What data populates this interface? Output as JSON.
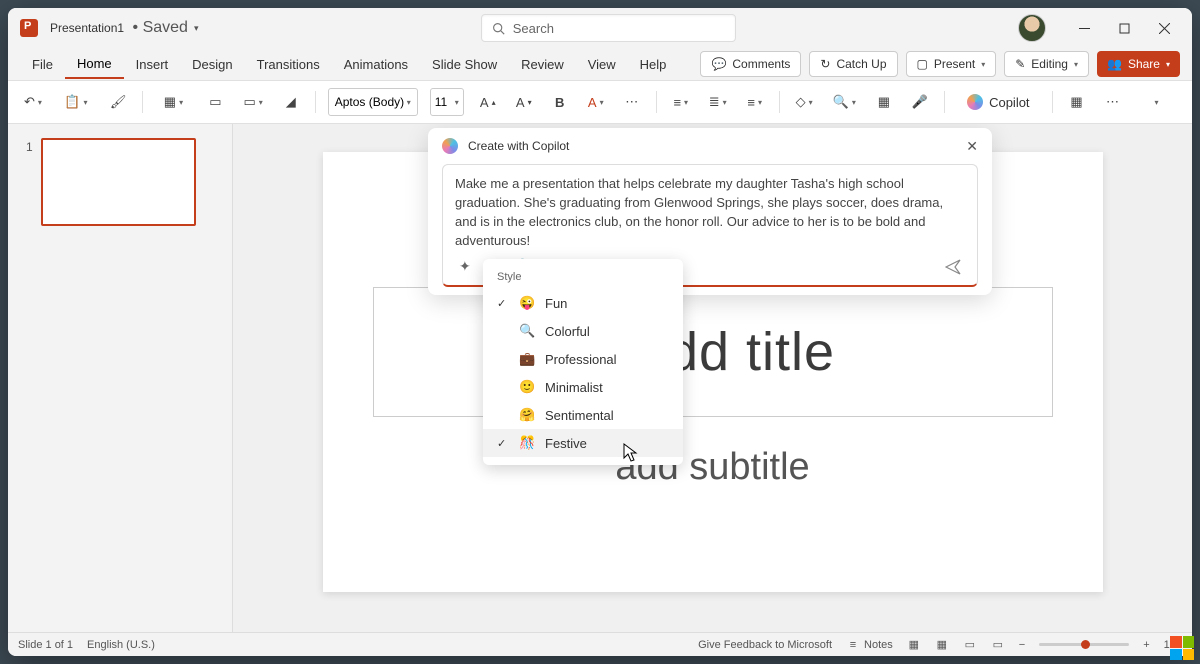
{
  "titlebar": {
    "doc_name": "Presentation1",
    "save_state": "Saved",
    "search_placeholder": "Search"
  },
  "menu": {
    "tabs": [
      "File",
      "Home",
      "Insert",
      "Design",
      "Transitions",
      "Animations",
      "Slide Show",
      "Review",
      "View",
      "Help"
    ],
    "active": "Home",
    "comments": "Comments",
    "catchup": "Catch Up",
    "present": "Present",
    "editing": "Editing",
    "share": "Share"
  },
  "ribbon": {
    "font_name": "Aptos (Body)",
    "font_size": "11",
    "copilot": "Copilot"
  },
  "thumbs": {
    "slide1_num": "1"
  },
  "slide": {
    "title_placeholder": "o add title",
    "subtitle_placeholder": "add subtitle"
  },
  "copilot_panel": {
    "title": "Create with Copilot",
    "prompt": "Make me a presentation that helps celebrate my daughter Tasha's high school graduation. She's graduating from Glenwood Springs, she plays soccer, does drama, and is in the electronics club, on the honor roll. Our advice to her is to be bold and adventurous!",
    "style_label": "Style",
    "styles": [
      {
        "label": "Fun",
        "emoji": "😜",
        "checked": true
      },
      {
        "label": "Colorful",
        "emoji": "🔍",
        "checked": false
      },
      {
        "label": "Professional",
        "emoji": "💼",
        "checked": false
      },
      {
        "label": "Minimalist",
        "emoji": "🙂",
        "checked": false
      },
      {
        "label": "Sentimental",
        "emoji": "🤗",
        "checked": false
      },
      {
        "label": "Festive",
        "emoji": "🎊",
        "checked": true
      }
    ]
  },
  "statusbar": {
    "slide_info": "Slide 1 of 1",
    "language": "English (U.S.)",
    "feedback": "Give Feedback to Microsoft",
    "notes": "Notes",
    "zoom": "100"
  }
}
